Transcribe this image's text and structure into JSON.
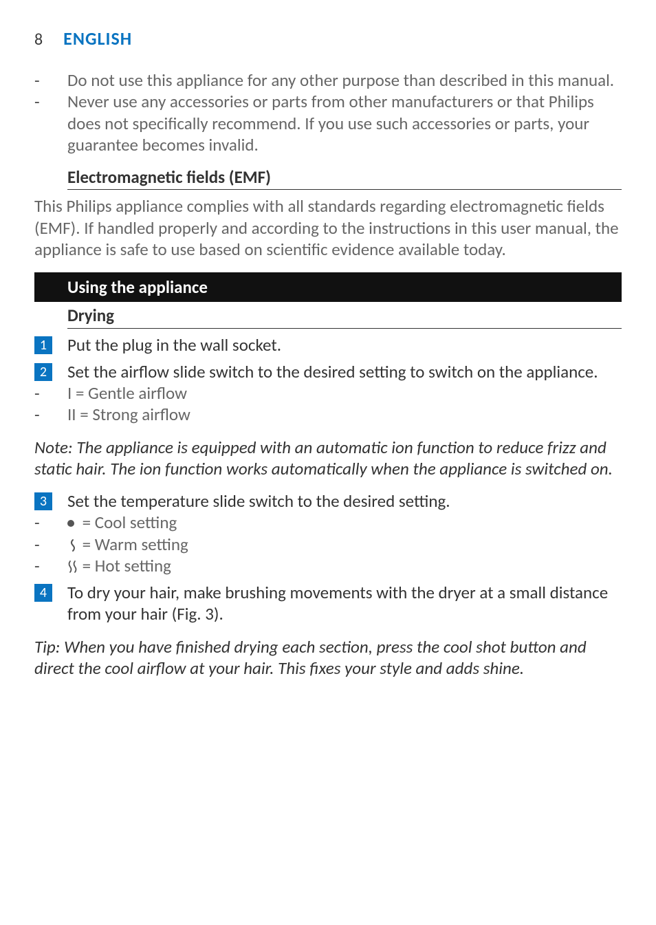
{
  "header": {
    "page_number": "8",
    "language": "ENGLISH"
  },
  "warnings": [
    "Do not use this appliance for any other purpose than described in this manual.",
    "Never use any accessories or parts from other manufacturers or that Philips does not specifically recommend. If you use such accessories or parts, your guarantee becomes invalid."
  ],
  "emf": {
    "heading": "Electromagnetic fields (EMF)",
    "body": "This Philips appliance complies with all standards regarding electromagnetic fields (EMF). If handled properly and according to the instructions in this user manual, the appliance is safe to use based on scientific evidence available today."
  },
  "section": {
    "title": "Using the appliance",
    "subheading": "Drying"
  },
  "steps": {
    "s1": {
      "n": "1",
      "text": "Put the plug in the wall socket."
    },
    "s2": {
      "n": "2",
      "text": "Set the airflow slide switch to the desired setting to switch on the appliance.",
      "opts": [
        "I = Gentle airflow",
        "II = Strong airflow"
      ]
    },
    "note": "Note: The appliance is equipped with an automatic ion function to reduce frizz and static hair. The ion function works automatically when the appliance is switched on.",
    "s3": {
      "n": "3",
      "text": "Set the temperature slide switch to the desired setting.",
      "opts": [
        " = Cool setting",
        " = Warm setting",
        " = Hot setting"
      ]
    },
    "s4": {
      "n": "4",
      "text": "To dry your hair, make brushing movements with the dryer at a small distance from your hair (Fig. 3)."
    },
    "tip": "Tip: When you have finished drying each section, press the cool shot button and direct the cool airflow at your hair. This fixes your style and adds shine."
  }
}
